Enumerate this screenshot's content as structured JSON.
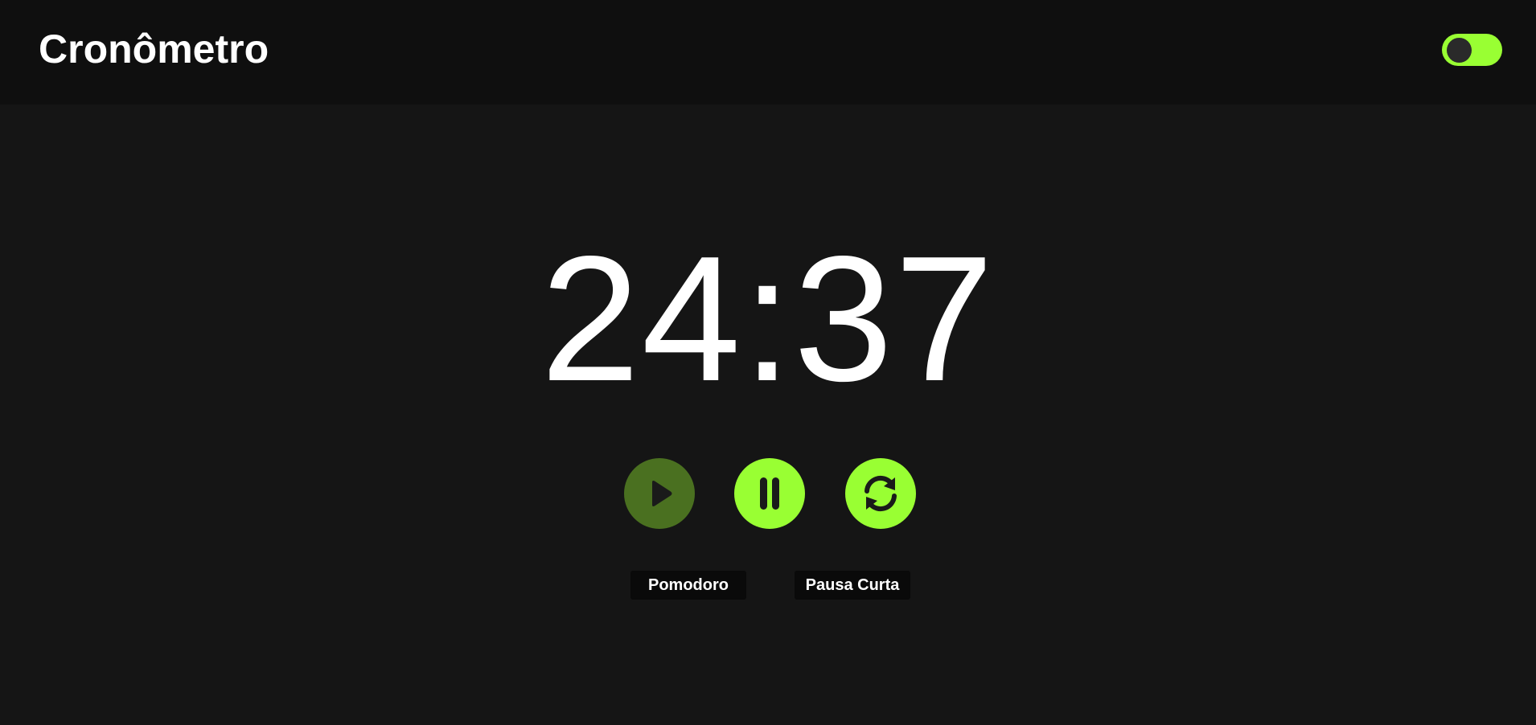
{
  "header": {
    "title": "Cronômetro",
    "theme_toggle": {
      "state": "on",
      "icon": "toggle-switch-icon"
    }
  },
  "timer": {
    "display": "24:37"
  },
  "controls": [
    {
      "name": "play",
      "icon": "play-icon",
      "state": "disabled"
    },
    {
      "name": "pause",
      "icon": "pause-icon",
      "state": "active"
    },
    {
      "name": "reset",
      "icon": "reset-icon",
      "state": "active"
    }
  ],
  "modes": [
    {
      "label": "Pomodoro"
    },
    {
      "label": "Pausa Curta"
    }
  ],
  "colors": {
    "accent": "#99ff33",
    "accent_dim": "#4a7020",
    "background": "#151515",
    "header_background": "#0f0f0f",
    "icon_dark": "#1a1a1a"
  }
}
